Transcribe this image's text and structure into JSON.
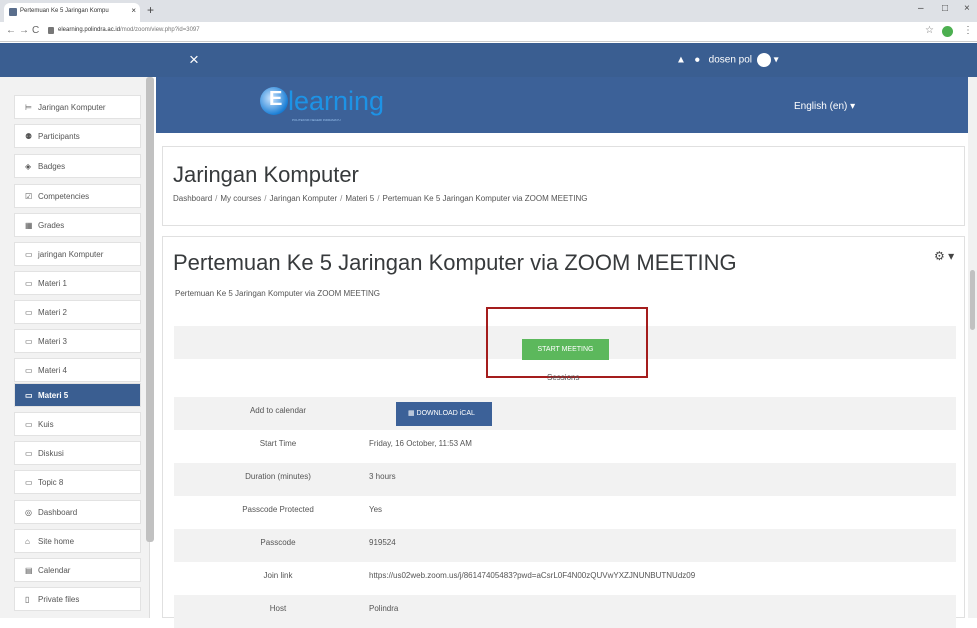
{
  "browser": {
    "tab_title": "Pertemuan Ke 5 Jaringan Kompu",
    "tab_close": "×",
    "new_tab": "+",
    "back": "←",
    "forward": "→",
    "reload": "C",
    "url_host": "elearning.polindra.ac.id",
    "url_path": "/mod/zoom/view.php?id=3097",
    "win_min": "–",
    "win_max": "□",
    "win_close": "×"
  },
  "navbar": {
    "close_symbol": "×",
    "bell": "▲",
    "chat": "●",
    "user_name": "dosen pol",
    "caret": "▾"
  },
  "banner": {
    "logo_letter": "E",
    "logo_word": "learning",
    "logo_tagline": "POLITEKNIK NEGERI INDRAMAYU",
    "language": "English (en) ▾"
  },
  "drawer": {
    "items": [
      {
        "icon": "⊨",
        "label": "Jaringan Komputer"
      },
      {
        "icon": "⚉",
        "label": "Participants"
      },
      {
        "icon": "◈",
        "label": "Badges"
      },
      {
        "icon": "☑",
        "label": "Competencies"
      },
      {
        "icon": "▦",
        "label": "Grades"
      },
      {
        "icon": "▭",
        "label": "jaringan Komputer"
      },
      {
        "icon": "▭",
        "label": "Materi 1"
      },
      {
        "icon": "▭",
        "label": "Materi 2"
      },
      {
        "icon": "▭",
        "label": "Materi 3"
      },
      {
        "icon": "▭",
        "label": "Materi 4"
      },
      {
        "icon": "▭",
        "label": "Materi 5"
      },
      {
        "icon": "▭",
        "label": "Kuis"
      },
      {
        "icon": "▭",
        "label": "Diskusi"
      },
      {
        "icon": "▭",
        "label": "Topic 8"
      },
      {
        "icon": "◎",
        "label": "Dashboard"
      },
      {
        "icon": "⌂",
        "label": "Site home"
      },
      {
        "icon": "▤",
        "label": "Calendar"
      },
      {
        "icon": "▯",
        "label": "Private files"
      }
    ],
    "active_index": 10
  },
  "header": {
    "course_title": "Jaringan Komputer",
    "breadcrumb": [
      "Dashboard",
      "My courses",
      "Jaringan Komputer",
      "Materi 5",
      "Pertemuan Ke 5 Jaringan Komputer via ZOOM MEETING"
    ],
    "sep": "/"
  },
  "main": {
    "title": "Pertemuan Ke 5 Jaringan Komputer via ZOOM MEETING",
    "gear": "⚙ ▾",
    "intro": "Pertemuan Ke 5 Jaringan Komputer via ZOOM MEETING",
    "start_meeting": "START MEETING",
    "sessions_label": "Sessions",
    "download_ical": "▦  DOWNLOAD iCAL",
    "rows": [
      {
        "label": "Add to calendar",
        "value": ""
      },
      {
        "label": "Start Time",
        "value": "Friday, 16  October, 11:53 AM"
      },
      {
        "label": "Duration (minutes)",
        "value": "3 hours"
      },
      {
        "label": "Passcode Protected",
        "value": "Yes"
      },
      {
        "label": "Passcode",
        "value": "919524"
      },
      {
        "label": "Join link",
        "value": "https://us02web.zoom.us/j/86147405483?pwd=aCsrL0F4N00zQUVwYXZJNUNBUTNUdz09"
      },
      {
        "label": "Host",
        "value": "Polindra"
      }
    ]
  }
}
